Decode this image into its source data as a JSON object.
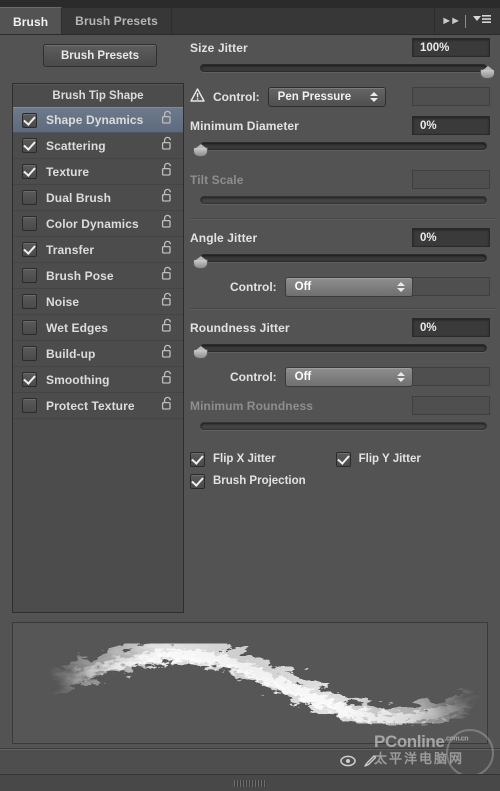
{
  "window": {
    "panel_tabs": [
      {
        "label": "Brush",
        "active": true
      },
      {
        "label": "Brush Presets",
        "active": false
      }
    ],
    "collapse_icon": "double-chevron-right-icon",
    "menu_icon": "panel-menu-icon"
  },
  "left": {
    "presets_button": "Brush Presets",
    "list_header": "Brush Tip Shape",
    "items": [
      {
        "label": "Shape Dynamics",
        "checked": true,
        "selected": true,
        "locked": false
      },
      {
        "label": "Scattering",
        "checked": true,
        "selected": false,
        "locked": false
      },
      {
        "label": "Texture",
        "checked": true,
        "selected": false,
        "locked": false
      },
      {
        "label": "Dual Brush",
        "checked": false,
        "selected": false,
        "locked": false
      },
      {
        "label": "Color Dynamics",
        "checked": false,
        "selected": false,
        "locked": false
      },
      {
        "label": "Transfer",
        "checked": true,
        "selected": false,
        "locked": false
      },
      {
        "label": "Brush Pose",
        "checked": false,
        "selected": false,
        "locked": false
      },
      {
        "label": "Noise",
        "checked": false,
        "selected": false,
        "locked": false
      },
      {
        "label": "Wet Edges",
        "checked": false,
        "selected": false,
        "locked": false
      },
      {
        "label": "Build-up",
        "checked": false,
        "selected": false,
        "locked": false
      },
      {
        "label": "Smoothing",
        "checked": true,
        "selected": false,
        "locked": false
      },
      {
        "label": "Protect Texture",
        "checked": false,
        "selected": false,
        "locked": false
      }
    ]
  },
  "right": {
    "size_jitter": {
      "label": "Size Jitter",
      "value": "100%",
      "slider_percent": 100,
      "control_label": "Control:",
      "control_value": "Pen Pressure",
      "has_warning": true,
      "warning_icon": "warning-triangle-icon"
    },
    "minimum_diameter": {
      "label": "Minimum Diameter",
      "value": "0%",
      "slider_percent": 0
    },
    "tilt_scale": {
      "label": "Tilt Scale",
      "value": "",
      "slider_percent": 0,
      "disabled": true
    },
    "angle_jitter": {
      "label": "Angle Jitter",
      "value": "0%",
      "slider_percent": 0,
      "control_label": "Control:",
      "control_value": "Off"
    },
    "roundness_jitter": {
      "label": "Roundness Jitter",
      "value": "0%",
      "slider_percent": 0,
      "control_label": "Control:",
      "control_value": "Off"
    },
    "minimum_roundness": {
      "label": "Minimum Roundness",
      "value": "",
      "slider_percent": 0,
      "disabled": true
    },
    "checkboxes": [
      {
        "label": "Flip X Jitter",
        "checked": true
      },
      {
        "label": "Flip Y Jitter",
        "checked": true
      },
      {
        "label": "Brush Projection",
        "checked": true
      }
    ]
  },
  "preview": {
    "name": "brush-stroke-preview"
  },
  "bottom_bar": {
    "icons": [
      {
        "name": "toggle-brush-preview-icon"
      },
      {
        "name": "new-brush-preset-icon"
      }
    ]
  },
  "watermark": {
    "brand": "PConline",
    "domain": ".com.cn",
    "chinese": "太平洋电脑网"
  },
  "colors": {
    "panel_bg": "#535353",
    "tabbar_bg": "#373737",
    "list_bg": "#4c4c4c",
    "selection": "#6d7a8c",
    "text": "#e2e2e2",
    "text_dim": "#8e8e8e",
    "field_bg": "#3a3a3a"
  }
}
